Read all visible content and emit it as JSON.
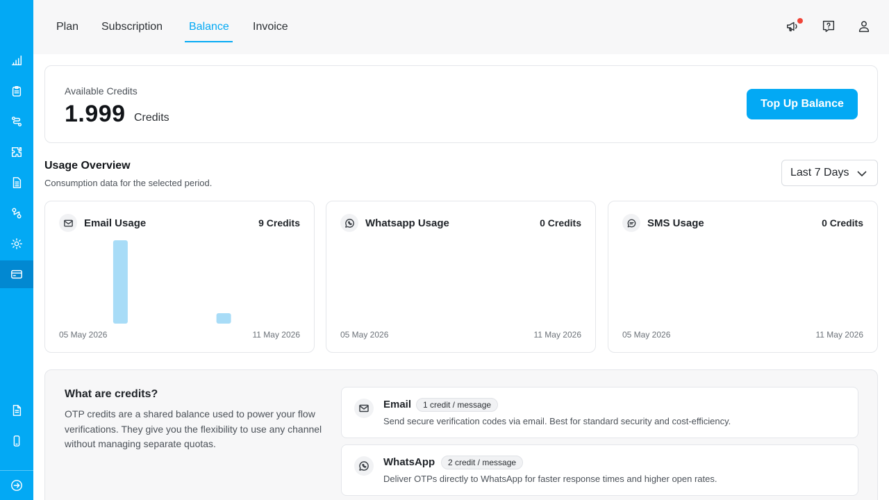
{
  "nav": {
    "tabs": [
      {
        "label": "Plan"
      },
      {
        "label": "Subscription"
      },
      {
        "label": "Balance"
      },
      {
        "label": "Invoice"
      }
    ],
    "active_tab": "Balance"
  },
  "credits": {
    "label": "Available Credits",
    "value": "1.999",
    "unit": "Credits",
    "topup_label": "Top Up Balance"
  },
  "usage": {
    "title": "Usage Overview",
    "subtitle": "Consumption data for the selected period.",
    "period": "Last 7 Days",
    "cards": [
      {
        "title": "Email Usage",
        "credits": "9 Credits",
        "start_date": "05 May 2026",
        "end_date": "11 May 2026",
        "icon": "mail-icon"
      },
      {
        "title": "Whatsapp Usage",
        "credits": "0 Credits",
        "start_date": "05 May 2026",
        "end_date": "11 May 2026",
        "icon": "whatsapp-icon"
      },
      {
        "title": "SMS Usage",
        "credits": "0 Credits",
        "start_date": "05 May 2026",
        "end_date": "11 May 2026",
        "icon": "sms-icon"
      }
    ]
  },
  "chart_data": [
    {
      "type": "bar",
      "categories": [
        "05 May 2026",
        "",
        "",
        "",
        "",
        "",
        "11 May 2026"
      ],
      "series": [
        {
          "values": [
            0,
            8,
            0,
            0,
            1,
            0,
            0
          ]
        }
      ],
      "ylim": [
        0,
        8
      ]
    },
    {
      "type": "bar",
      "categories": [
        "05 May 2026",
        "",
        "",
        "",
        "",
        "",
        "11 May 2026"
      ],
      "series": [
        {
          "values": [
            0,
            0,
            0,
            0,
            0,
            0,
            0
          ]
        }
      ],
      "ylim": [
        0,
        8
      ]
    },
    {
      "type": "bar",
      "categories": [
        "05 May 2026",
        "",
        "",
        "",
        "",
        "",
        "11 May 2026"
      ],
      "series": [
        {
          "values": [
            0,
            0,
            0,
            0,
            0,
            0,
            0
          ]
        }
      ],
      "ylim": [
        0,
        8
      ]
    }
  ],
  "info": {
    "title": "What are credits?",
    "body": "OTP credits are a shared balance used to power your flow verifications. They give you the flexibility to use any channel without managing separate quotas.",
    "channels": [
      {
        "name": "Email",
        "badge": "1 credit / message",
        "desc": "Send secure verification codes via email. Best for standard security and cost-efficiency."
      },
      {
        "name": "WhatsApp",
        "badge": "2 credit / message",
        "desc": "Deliver OTPs directly to WhatsApp for faster response times and higher open rates."
      }
    ]
  },
  "colors": {
    "accent": "#03a9f4",
    "bar": "#a8dcf7",
    "notification": "#f04438"
  }
}
